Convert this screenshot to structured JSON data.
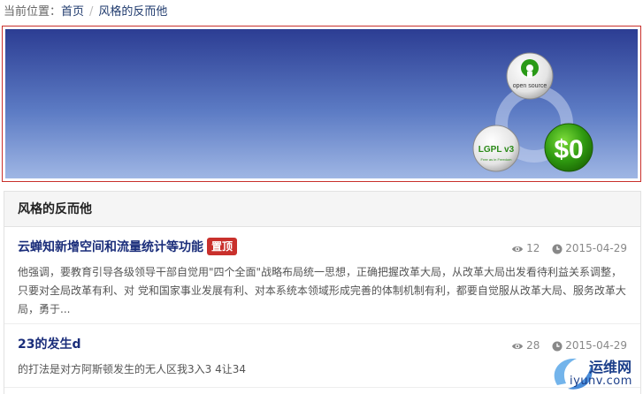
{
  "breadcrumb": {
    "label": "当前位置：",
    "items": [
      "首页",
      "风格的反而他"
    ],
    "separator": "/"
  },
  "banner": {
    "opensource_label": "open source",
    "lgpl_label": "LGPL v3",
    "lgpl_sub": "Free as in Freedom",
    "price_label": "$0",
    "colors": {
      "top": "#2c3d93",
      "bottom": "#9fb6e4",
      "border": "#c9302c"
    }
  },
  "panel": {
    "title": "风格的反而他"
  },
  "posts": [
    {
      "title": "云蝉知新增空间和流量统计等功能",
      "badge": "置顶",
      "views": "12",
      "date": "2015-04-29",
      "summary": "他强调，要教育引导各级领导干部自觉用\"四个全面\"战略布局统一思想，正确把握改革大局，从改革大局出发看待利益关系调整，只要对全局改革有利、对 党和国家事业发展有利、对本系统本领域形成完善的体制机制有利，都要自觉服从改革大局、服务改革大局，勇于..."
    },
    {
      "title": "23的发生d",
      "views": "28",
      "date": "2015-04-29",
      "summary": "的打法是对方阿斯顿发生的无人区我3入3 4让34"
    }
  ],
  "watermark": {
    "cn": "运维网",
    "en": "iyunv.com"
  },
  "icons": [
    "eye-icon",
    "clock-icon",
    "opensource-logo",
    "lgpl-logo",
    "dollar-zero-logo"
  ]
}
